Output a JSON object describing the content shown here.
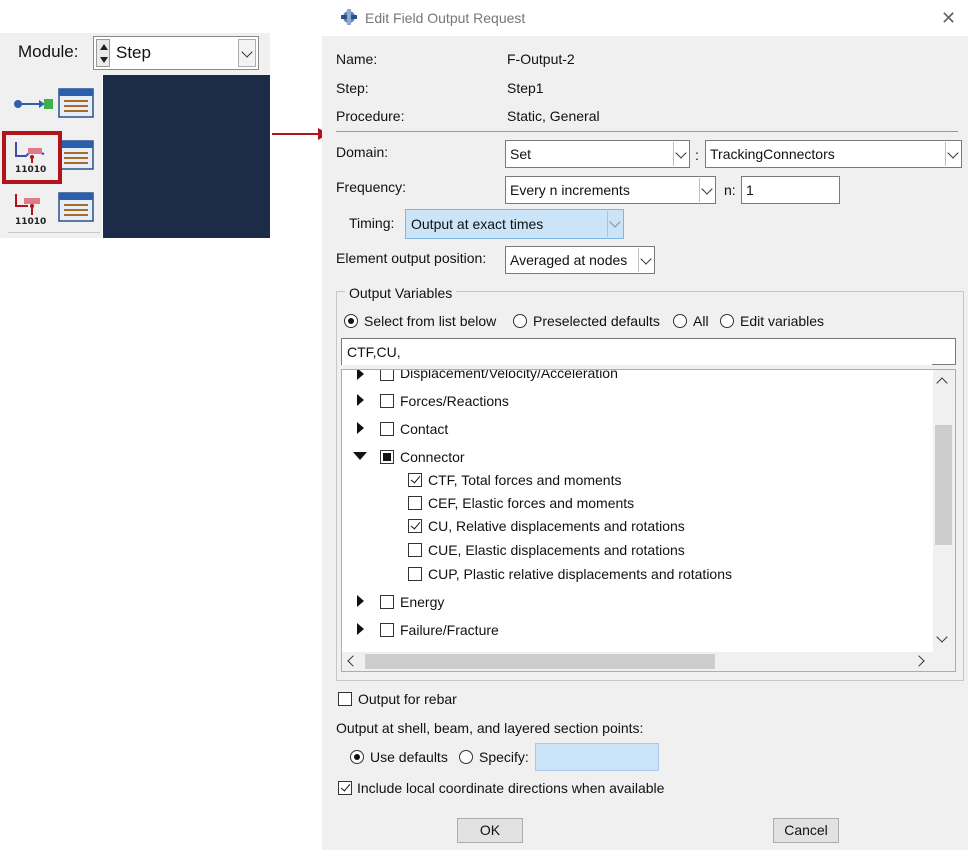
{
  "module": {
    "label": "Module:",
    "value": "Step"
  },
  "dialog": {
    "title": "Edit Field Output Request",
    "name_label": "Name:",
    "name_value": "F-Output-2",
    "step_label": "Step:",
    "step_value": "Step1",
    "procedure_label": "Procedure:",
    "procedure_value": "Static, General",
    "domain_label": "Domain:",
    "domain_type": "Set",
    "domain_sep": ":",
    "domain_value": "TrackingConnectors",
    "frequency_label": "Frequency:",
    "frequency_value": "Every n increments",
    "n_label": "n:",
    "n_value": "1",
    "timing_label": "Timing:",
    "timing_value": "Output at exact times",
    "elem_pos_label": "Element output position:",
    "elem_pos_value": "Averaged at nodes",
    "output_vars": {
      "group_title": "Output Variables",
      "radio_options": [
        "Select from list below",
        "Preselected defaults",
        "All",
        "Edit variables"
      ],
      "selected_option": "Select from list below",
      "filter_value": "CTF,CU,",
      "tree": [
        {
          "label": "Displacement/Velocity/Acceleration",
          "expanded": false,
          "state": "unchecked"
        },
        {
          "label": "Forces/Reactions",
          "expanded": false,
          "state": "unchecked"
        },
        {
          "label": "Contact",
          "expanded": false,
          "state": "unchecked"
        },
        {
          "label": "Connector",
          "expanded": true,
          "state": "partial"
        },
        {
          "label": "CTF, Total forces and moments",
          "child": true,
          "state": "checked"
        },
        {
          "label": "CEF, Elastic forces and moments",
          "child": true,
          "state": "unchecked"
        },
        {
          "label": "CU, Relative displacements and rotations",
          "child": true,
          "state": "checked"
        },
        {
          "label": "CUE, Elastic displacements and rotations",
          "child": true,
          "state": "unchecked"
        },
        {
          "label": "CUP, Plastic relative displacements and rotations",
          "child": true,
          "state": "unchecked"
        },
        {
          "label": "Energy",
          "expanded": false,
          "state": "unchecked"
        },
        {
          "label": "Failure/Fracture",
          "expanded": false,
          "state": "unchecked"
        }
      ]
    },
    "rebar_label": "Output for rebar",
    "section_points_label": "Output at shell, beam, and layered section points:",
    "use_defaults_label": "Use defaults",
    "specify_label": "Specify:",
    "local_coord_label": "Include local coordinate directions when available",
    "ok_label": "OK",
    "cancel_label": "Cancel"
  },
  "colors": {
    "highlight": "#b2141a",
    "viewport": "#1c2b47",
    "selection": "#cce4f7"
  }
}
